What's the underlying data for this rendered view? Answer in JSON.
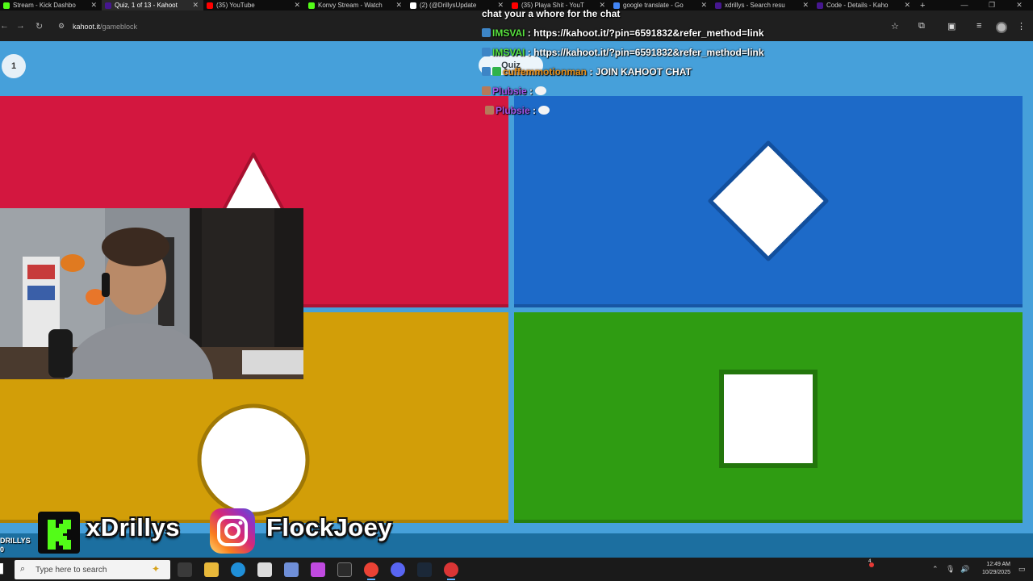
{
  "browser": {
    "tabs": [
      {
        "label": "Stream - Kick Dashbo",
        "favicon_color": "#53fc18",
        "active": false
      },
      {
        "label": "Quiz, 1 of 13 - Kahoot",
        "favicon_color": "#46178f",
        "active": true
      },
      {
        "label": "(35) YouTube",
        "favicon_color": "#ff0000",
        "active": false
      },
      {
        "label": "Konvy Stream - Watch",
        "favicon_color": "#53fc18",
        "active": false
      },
      {
        "label": "(2) (@DrillysUpdate",
        "favicon_color": "#ffffff",
        "active": false
      },
      {
        "label": "(35) Playa Shit - YouT",
        "favicon_color": "#ff0000",
        "active": false
      },
      {
        "label": "google translate - Go",
        "favicon_color": "#4285f4",
        "active": false
      },
      {
        "label": "xdrillys - Search resu",
        "favicon_color": "#46178f",
        "active": false
      },
      {
        "label": "Code - Details - Kaho",
        "favicon_color": "#46178f",
        "active": false
      }
    ],
    "new_tab_symbol": "+",
    "url_host": "kahoot.it",
    "url_path": "/gameblock"
  },
  "game": {
    "question_number": "1",
    "quiz_label": "Quiz",
    "answers": [
      {
        "shape": "triangle",
        "color": "#d3173f"
      },
      {
        "shape": "diamond",
        "color": "#1d6ac8"
      },
      {
        "shape": "circle",
        "color": "#d29e08"
      },
      {
        "shape": "square",
        "color": "#2f9c12"
      }
    ]
  },
  "chat": {
    "top_message": "chat your a whore for the chat",
    "messages": [
      {
        "user": "IMSVAI",
        "text": ": https://kahoot.it/?pin=6591832&refer_method=link",
        "color": "#58e03f"
      },
      {
        "user": "IMSVAI",
        "text": ": https://kahoot.it/?pin=6591832&refer_method=link",
        "color": "#58e03f"
      },
      {
        "user": "cuffemmotionman",
        "text": ": JOIN KAHOOT CHAT",
        "color": "#e58f1a"
      },
      {
        "user": "Plubsie",
        "text": ":",
        "color": "#a555e8"
      },
      {
        "user": "Plubsie",
        "text": ":",
        "color": "#a555e8"
      }
    ]
  },
  "socials": {
    "kick_handle": "xDrillys",
    "instagram_handle": "FlockJoey",
    "corner_label_line1": "DRILLYS",
    "corner_label_line2": "0"
  },
  "taskbar": {
    "search_placeholder": "Type here to search",
    "time": "12:49 AM",
    "date": "10/29/2025",
    "notification_count": "4"
  }
}
